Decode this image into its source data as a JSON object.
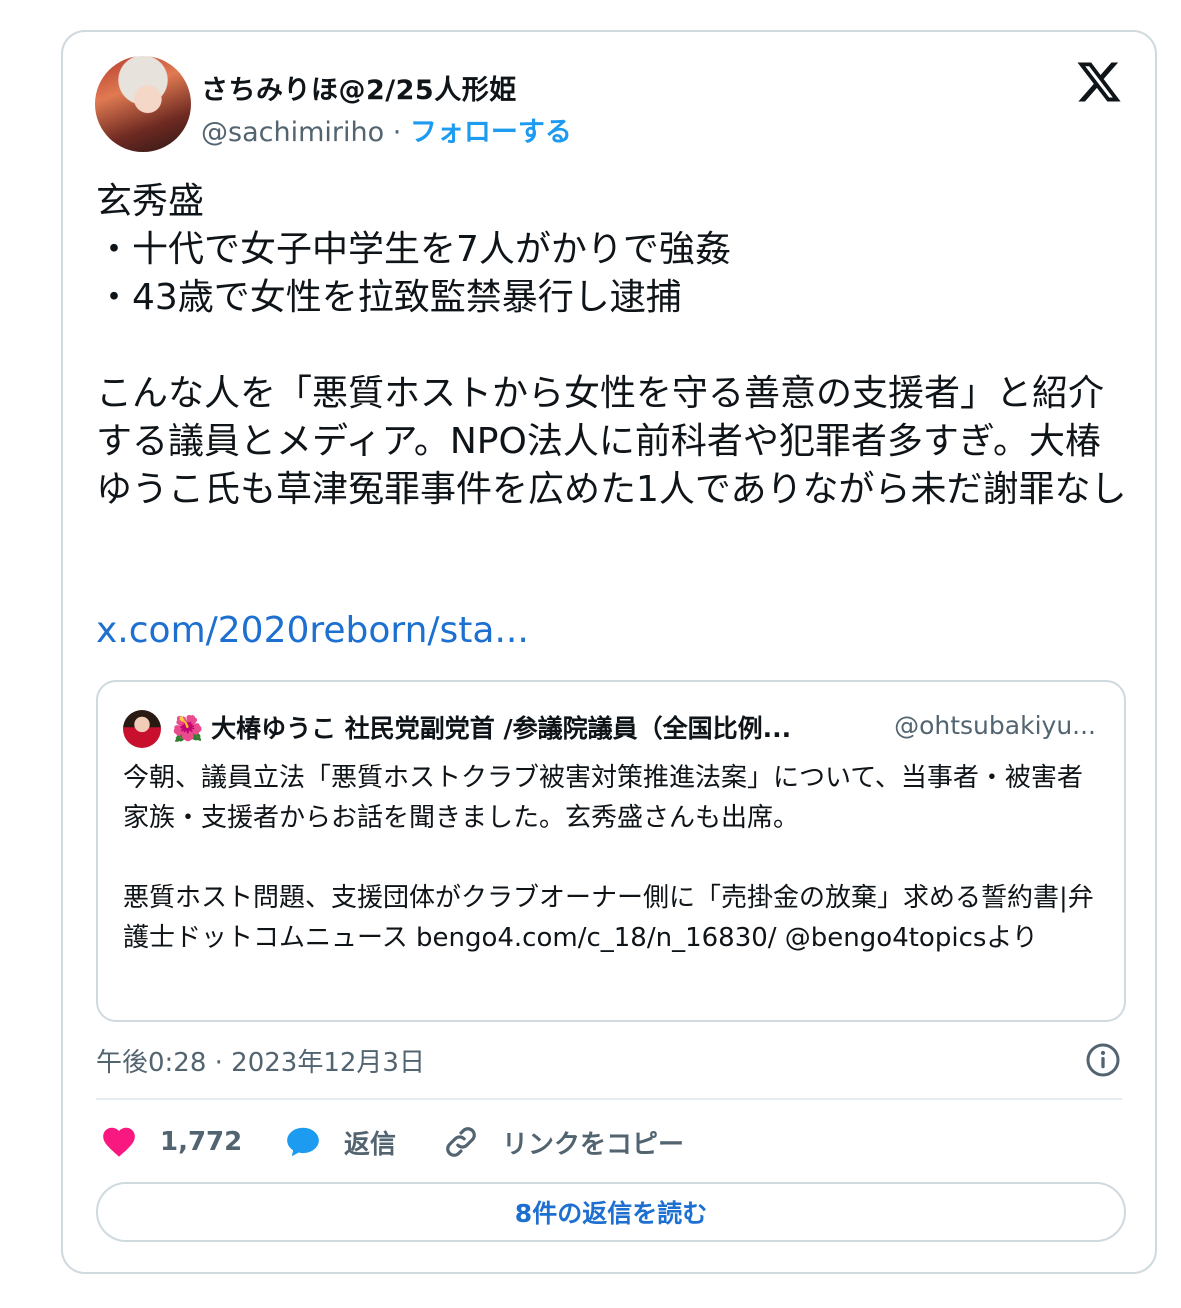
{
  "author": {
    "display_name": "さちみりほ@2/25人形姫",
    "handle": "@sachimiriho",
    "separator": "·",
    "follow_label": "フォローする"
  },
  "tweet": {
    "text": "玄秀盛\n・十代で女子中学生を7人がかりで強姦\n・43歳で女性を拉致監禁暴行し逮捕\n\nこんな人を「悪質ホストから女性を守る善意の支援者」と紹介する議員とメディア。NPO法人に前科者や犯罪者多すぎ。大椿ゆうこ氏も草津冤罪事件を広めた1人でありながら未だ謝罪なし",
    "link": "x.com/2020reborn/sta..."
  },
  "quote": {
    "flower": "🌺",
    "name": "大椿ゆうこ 社民党副党首 /参議院議員（全国比例...",
    "handle": "@ohtsubakiyu...",
    "text": "今朝、議員立法「悪質ホストクラブ被害対策推進法案」について、当事者・被害者家族・支援者からお話を聞きました。玄秀盛さんも出席。\n\n悪質ホスト問題、支援団体がクラブオーナー側に「売掛金の放棄」求める誓約書|弁護士ドットコムニュース bengo4.com/c_18/n_16830/ @bengo4topicsより"
  },
  "timestamp": "午後0:28 · 2023年12月3日",
  "actions": {
    "like_count": "1,772",
    "reply_label": "返信",
    "copy_link_label": "リンクをコピー"
  },
  "read_replies_label": "8件の返信を読む",
  "colors": {
    "accent": "#1d9bf0",
    "link": "#1d6fd0",
    "like": "#f91880",
    "muted": "#536471",
    "border": "#cfd9de"
  },
  "icons": [
    "x-logo-icon",
    "info-icon",
    "heart-icon",
    "reply-bubble-icon",
    "link-icon"
  ]
}
